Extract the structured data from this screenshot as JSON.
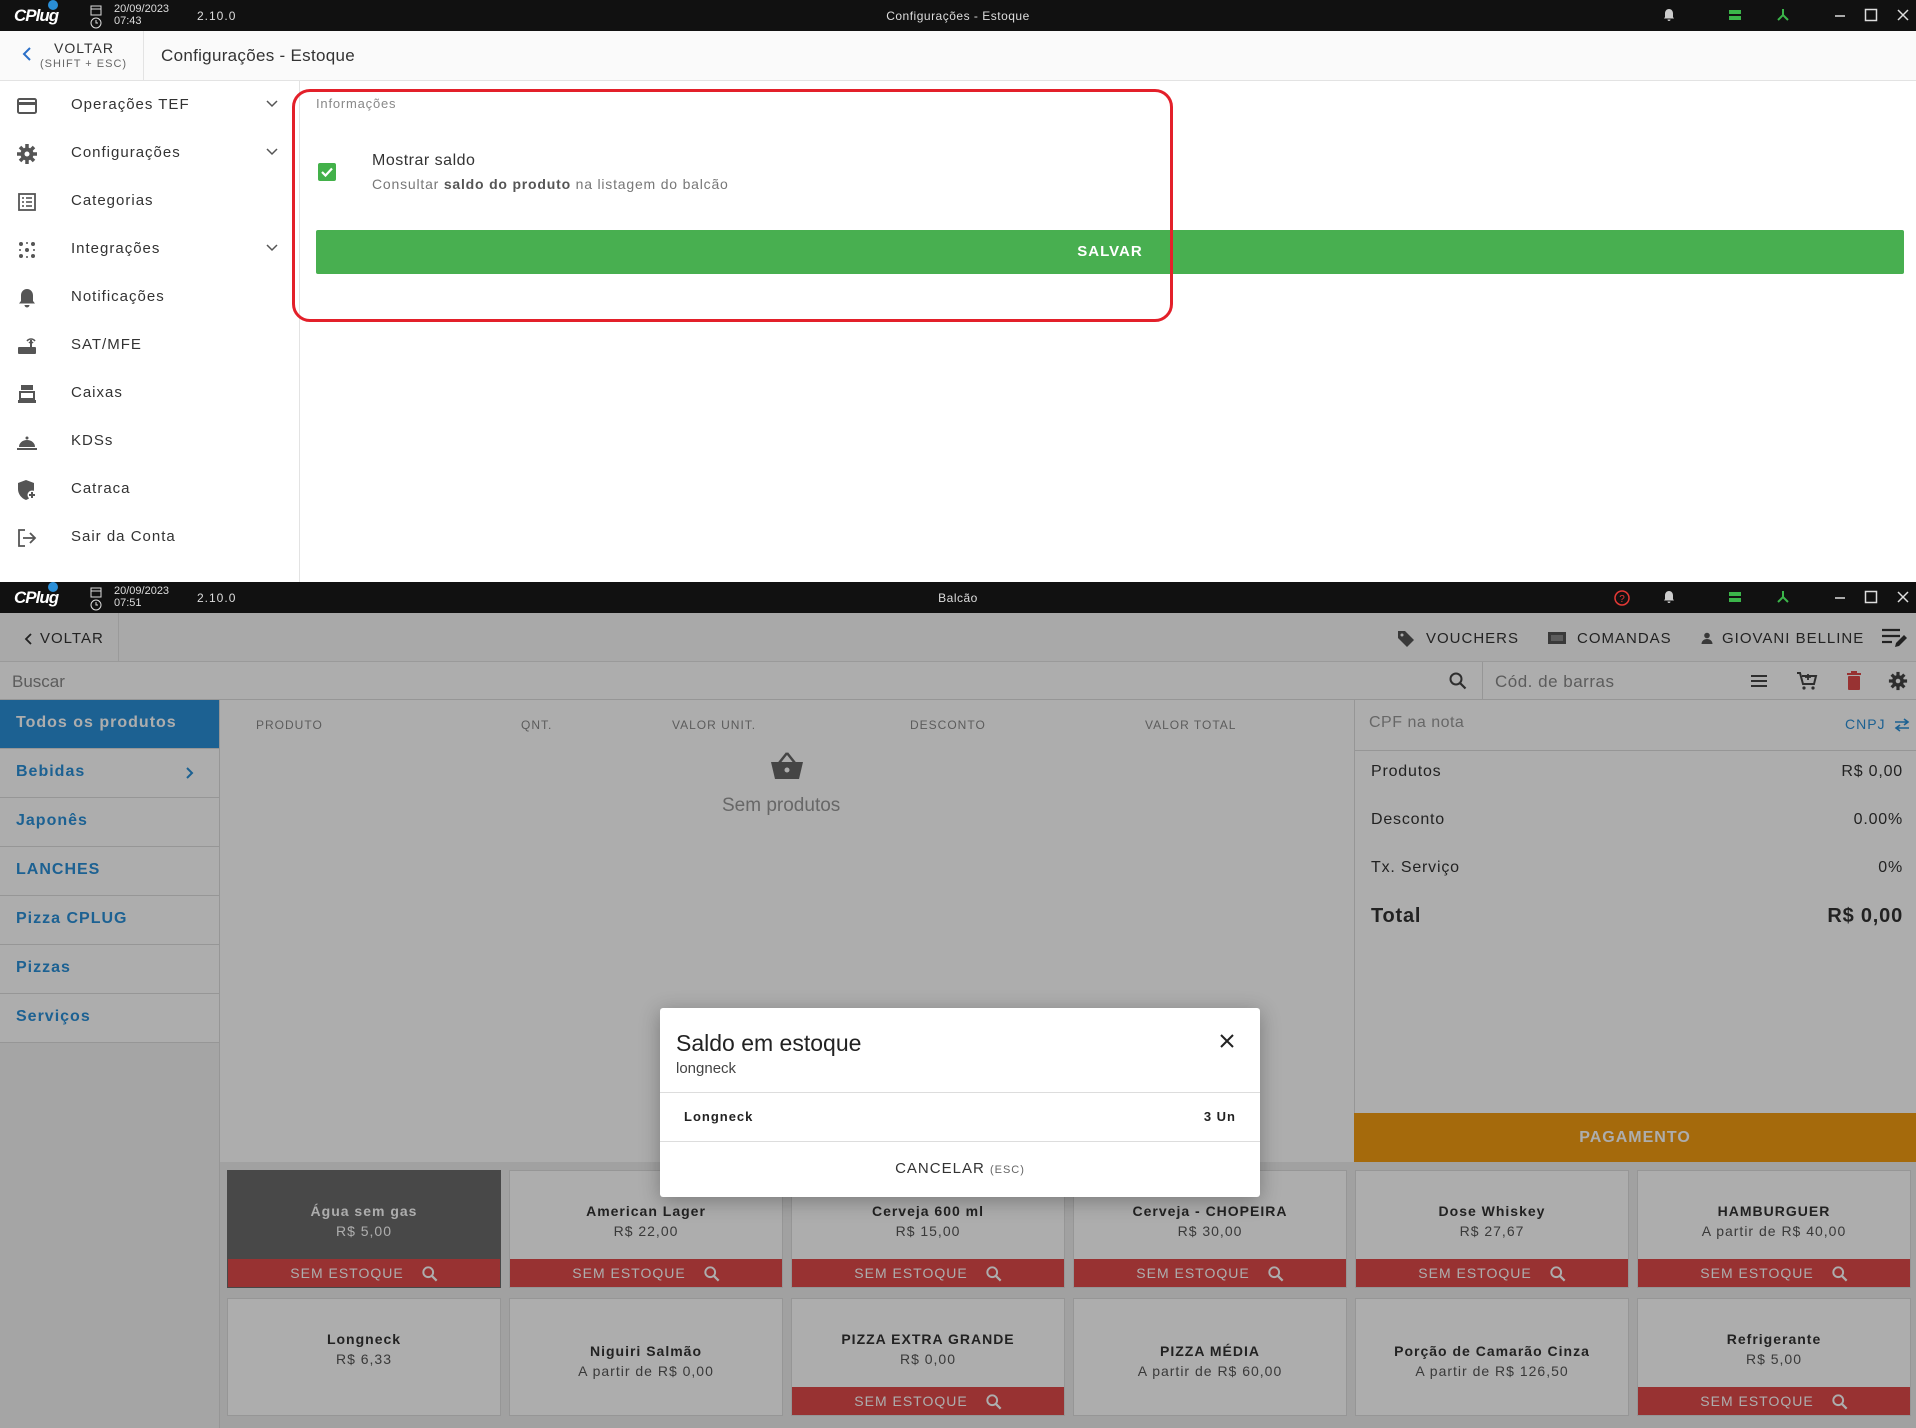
{
  "window1": {
    "logo": "CPlug",
    "date": "20/09/2023",
    "time": "07:43",
    "version": "2.10.0",
    "title": "Configurações - Estoque",
    "back_label": "VOLTAR",
    "back_shortcut": "(SHIFT + ESC)",
    "page_title": "Configurações - Estoque",
    "sidebar": [
      {
        "label": "Operações TEF",
        "icon": "credit-card-icon",
        "expandable": true
      },
      {
        "label": "Configurações",
        "icon": "gear-icon",
        "expandable": true
      },
      {
        "label": "Categorias",
        "icon": "list-icon",
        "expandable": false
      },
      {
        "label": "Integrações",
        "icon": "integration-icon",
        "expandable": true
      },
      {
        "label": "Notificações",
        "icon": "bell-icon",
        "expandable": false
      },
      {
        "label": "SAT/MFE",
        "icon": "router-icon",
        "expandable": false
      },
      {
        "label": "Caixas",
        "icon": "register-icon",
        "expandable": false
      },
      {
        "label": "KDSs",
        "icon": "kitchen-icon",
        "expandable": false
      },
      {
        "label": "Catraca",
        "icon": "shield-icon",
        "expandable": false
      },
      {
        "label": "Sair da Conta",
        "icon": "logout-icon",
        "expandable": false
      }
    ],
    "section_label": "Informações",
    "option": {
      "title": "Mostrar saldo",
      "desc_pre": "Consultar ",
      "desc_bold": "saldo do produto",
      "desc_post": " na listagem do balcão",
      "checked": true
    },
    "save_label": "SALVAR",
    "highlight_color": "#e3202a"
  },
  "window2": {
    "date": "20/09/2023",
    "time": "07:51",
    "version": "2.10.0",
    "title": "Balcão",
    "back_label": "VOLTAR",
    "header_buttons": [
      "VOUCHERS",
      "COMANDAS",
      "GIOVANI BELLINE"
    ],
    "search_placeholder": "Buscar",
    "barcode_placeholder": "Cód. de barras",
    "categories": [
      "Todos os produtos",
      "Bebidas",
      "Japonês",
      "LANCHES",
      "Pizza CPLUG",
      "Pizzas",
      "Serviços"
    ],
    "table_columns": [
      "PRODUTO",
      "QNT.",
      "VALOR UNIT.",
      "DESCONTO",
      "VALOR TOTAL"
    ],
    "empty_text": "Sem produtos",
    "cpf_placeholder": "CPF na nota",
    "cnpj_label": "CNPJ",
    "summary": {
      "produtos_label": "Produtos",
      "produtos_value": "R$ 0,00",
      "desconto_label": "Desconto",
      "desconto_value": "0.00%",
      "taxa_label": "Tx. Serviço",
      "taxa_value": "0%",
      "total_label": "Total",
      "total_value": "R$ 0,00"
    },
    "payment_label": "PAGAMENTO",
    "no_stock_label": "SEM ESTOQUE",
    "products": [
      {
        "name": "Água sem gas",
        "price": "R$ 5,00",
        "no_stock": true
      },
      {
        "name": "American Lager",
        "price": "R$ 22,00",
        "no_stock": true
      },
      {
        "name": "Cerveja 600 ml",
        "price": "R$ 15,00",
        "no_stock": true
      },
      {
        "name": "Cerveja - CHOPEIRA",
        "price": "R$ 30,00",
        "no_stock": true
      },
      {
        "name": "Dose Whiskey",
        "price": "R$ 27,67",
        "no_stock": true
      },
      {
        "name": "HAMBURGUER",
        "price": "A partir de R$ 40,00",
        "no_stock": true
      },
      {
        "name": "Longneck",
        "price": "R$ 6,33",
        "no_stock": false
      },
      {
        "name": "Niguiri Salmão",
        "price": "A partir de R$ 0,00",
        "no_stock": false
      },
      {
        "name": "PIZZA EXTRA GRANDE",
        "price": "R$ 0,00",
        "no_stock": true
      },
      {
        "name": "PIZZA MÉDIA",
        "price": "A partir de R$ 60,00",
        "no_stock": false
      },
      {
        "name": "Porção de Camarão Cinza",
        "price": "A partir de R$ 126,50",
        "no_stock": false
      },
      {
        "name": "Refrigerante",
        "price": "R$ 5,00",
        "no_stock": true
      }
    ],
    "modal": {
      "title": "Saldo em estoque",
      "subtitle": "longneck",
      "item": "Longneck",
      "qty": "3 Un",
      "cancel": "CANCELAR",
      "cancel_shortcut": "(ESC)"
    }
  }
}
